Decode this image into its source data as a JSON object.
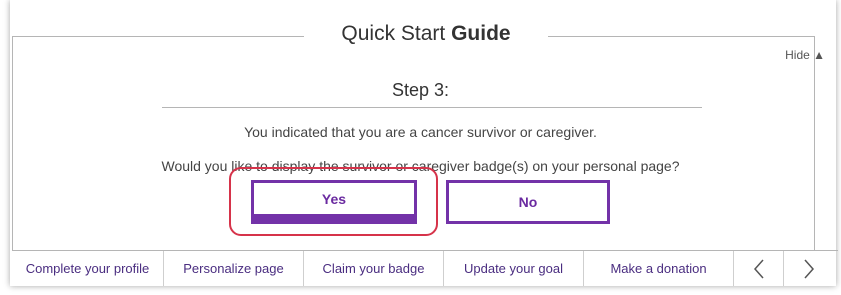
{
  "guide": {
    "title_main": "Quick Start ",
    "title_bold": "Guide",
    "hide_label": "Hide ▲"
  },
  "step": {
    "label": "Step 3:",
    "message": "You indicated that you are a cancer survivor or caregiver.",
    "question": "Would you like to display the survivor or caregiver badge(s) on your personal page?"
  },
  "buttons": {
    "yes": "Yes",
    "no": "No"
  },
  "tabs": [
    {
      "label": "Complete your profile"
    },
    {
      "label": "Personalize page"
    },
    {
      "label": "Claim your badge"
    },
    {
      "label": "Update your goal"
    },
    {
      "label": "Make a donation"
    }
  ],
  "nav": {
    "prev_icon": "chevron-left-icon",
    "next_icon": "chevron-right-icon"
  },
  "colors": {
    "accent": "#7332a8",
    "highlight": "#d6334a",
    "tab_text": "#4a2d80"
  }
}
